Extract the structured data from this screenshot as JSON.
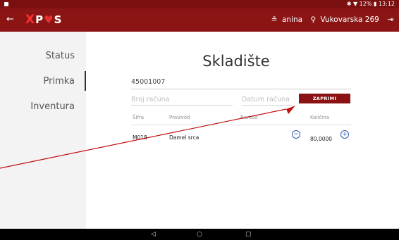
{
  "status_bar": {
    "right_text": "✱ ▼ 12% ▮ 13:12",
    "notification_icon": "notification-icon"
  },
  "app_bar": {
    "back_glyph": "←",
    "logo_x": "X",
    "logo_rest": "P",
    "logo_sym": "♥",
    "logo_s": "S",
    "user_icon": "≗",
    "username": "anina",
    "location_icon": "⚲",
    "location": "Vukovarska 269",
    "logout_glyph": "⇥"
  },
  "sidebar": {
    "items": [
      {
        "label": "Status"
      },
      {
        "label": "Primka"
      },
      {
        "label": "Inventura"
      }
    ]
  },
  "main": {
    "title": "Skladište",
    "document_number": "45001007",
    "invoice_placeholder": "Broj računa",
    "date_placeholder": "Datum računa",
    "receive_button": "ZAPRIMI"
  },
  "table": {
    "columns": [
      "Šifra",
      "Proizvod",
      "Barkod",
      "Količina"
    ],
    "rows": [
      {
        "code": "M018",
        "product": "Damel srca",
        "barcode": "",
        "quantity": "80,0000"
      }
    ]
  },
  "nav_bar": {
    "back": "◁",
    "home": "○",
    "recent": "▢"
  }
}
